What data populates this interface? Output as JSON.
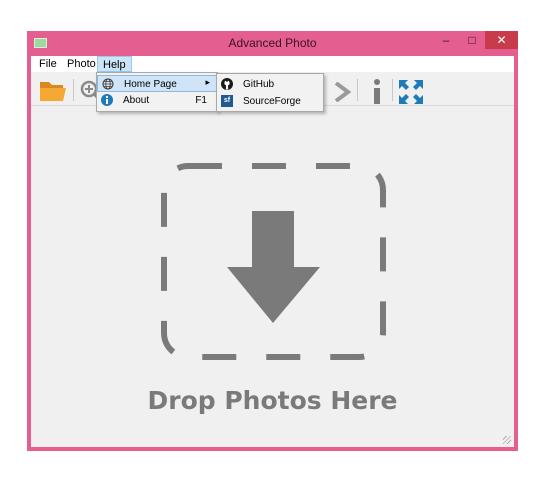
{
  "window": {
    "title": "Advanced Photo",
    "controls": {
      "minimize": "–",
      "maximize": "□",
      "close": "✕"
    }
  },
  "menubar": {
    "file": "File",
    "photo": "Photo",
    "help": "Help"
  },
  "help_menu": {
    "home_page": "Home Page",
    "about": "About",
    "about_shortcut": "F1",
    "submenu_arrow": "▸"
  },
  "home_submenu": {
    "github": "GitHub",
    "sourceforge": "SourceForge",
    "sourceforge_badge": "sf"
  },
  "dropzone": {
    "text": "Drop Photos Here"
  },
  "colors": {
    "window_frame": "#e45f8f",
    "close_button": "#c73b4a",
    "menu_highlight": "#cce4f7",
    "toolbar_accent_blue": "#1f7ab8",
    "folder_orange": "#f0a030",
    "dropzone_gray": "#7a7a7a"
  },
  "icons": {
    "toolbar": [
      "folder-open-icon",
      "zoom-in-icon",
      "next-arrow-icon",
      "info-icon",
      "fullscreen-icon"
    ],
    "help_menu": [
      "globe-icon",
      "info-icon"
    ],
    "home_submenu": [
      "github-icon",
      "sourceforge-icon"
    ]
  }
}
